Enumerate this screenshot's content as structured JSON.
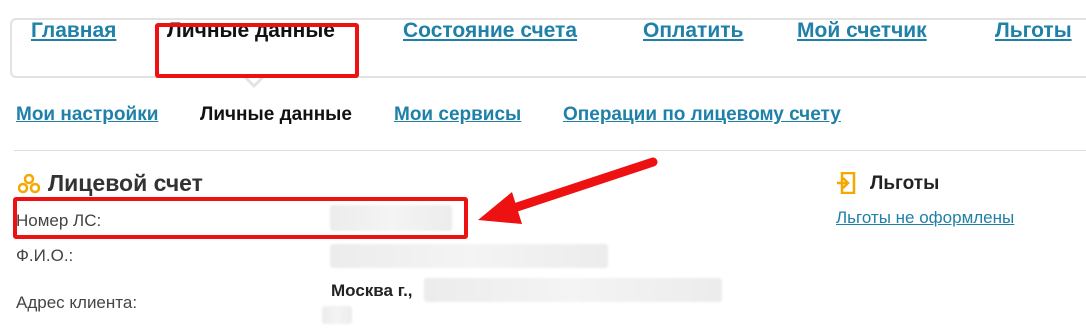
{
  "topnav": {
    "tabs": [
      {
        "label": "Главная",
        "active": false
      },
      {
        "label": "Личные данные",
        "active": true
      },
      {
        "label": "Состояние счета",
        "active": false
      },
      {
        "label": "Оплатить",
        "active": false
      },
      {
        "label": "Мой счетчик",
        "active": false
      },
      {
        "label": "Льготы",
        "active": false
      }
    ]
  },
  "subnav": {
    "tabs": [
      {
        "label": "Мои настройки",
        "active": false
      },
      {
        "label": "Личные данные",
        "active": true
      },
      {
        "label": "Мои сервисы",
        "active": false
      },
      {
        "label": "Операции по лицевому счету",
        "active": false
      }
    ]
  },
  "account": {
    "icon": "account-group-icon",
    "title": "Лицевой счет",
    "account_number_label": "Номер ЛС:",
    "name_label": "Ф.И.О.:",
    "address_label": "Адрес клиента:",
    "address_value": "Москва г.,"
  },
  "benefits": {
    "icon": "benefits-icon",
    "title": "Льготы",
    "link": "Льготы не оформлены"
  },
  "colors": {
    "link": "#1f80a8",
    "highlight": "#ee1111",
    "accent_icon": "#f5a800"
  }
}
